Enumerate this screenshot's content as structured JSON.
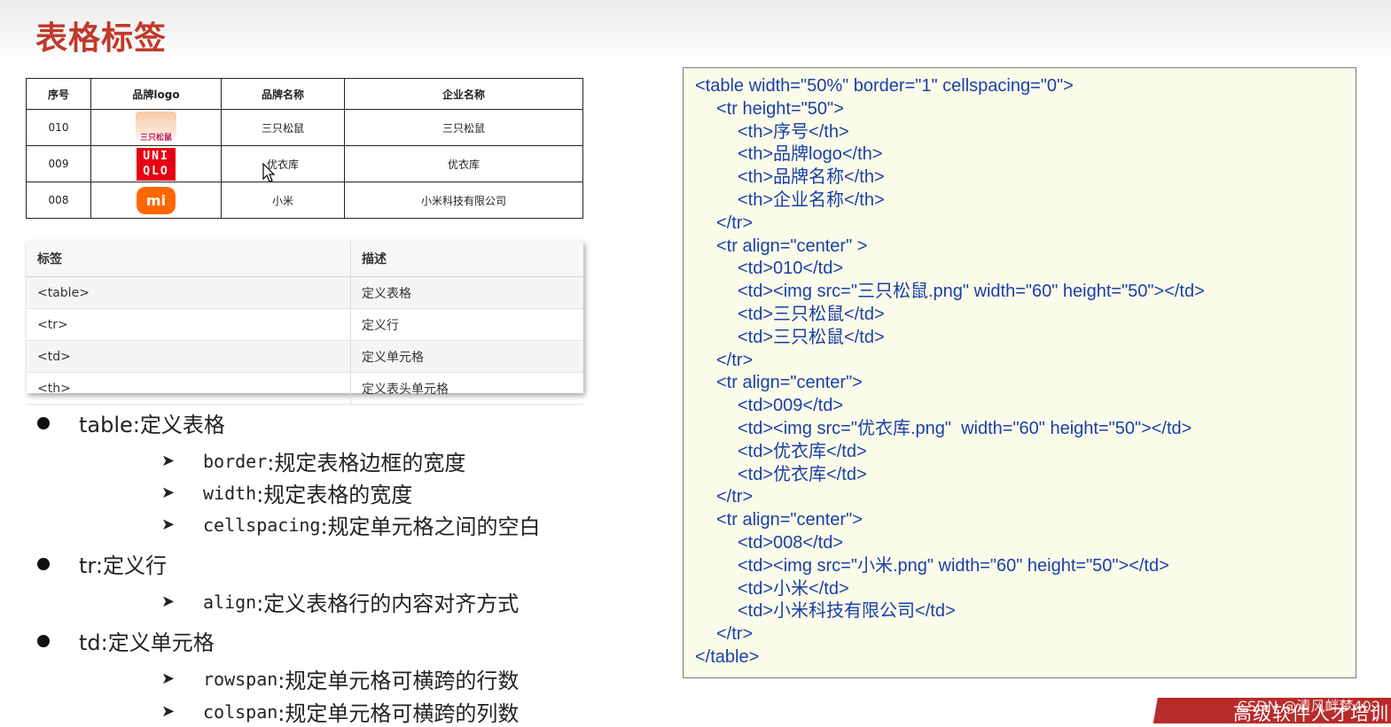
{
  "slide": {
    "title": "表格标签"
  },
  "demo_table": {
    "headers": [
      "序号",
      "品牌logo",
      "品牌名称",
      "企业名称"
    ],
    "rows": [
      {
        "id": "010",
        "logo": "三只松鼠",
        "brand": "三只松鼠",
        "company": "三只松鼠"
      },
      {
        "id": "009",
        "logo": "UNI QLO",
        "logo_line1": "UNI",
        "logo_line2": "QLO",
        "brand": "优衣库",
        "company": "优衣库"
      },
      {
        "id": "008",
        "logo": "mi",
        "brand": "小米",
        "company": "小米科技有限公司"
      }
    ]
  },
  "tag_table": {
    "headers": [
      "标签",
      "描述"
    ],
    "rows": [
      {
        "tag": "<table>",
        "desc": "定义表格"
      },
      {
        "tag": "<tr>",
        "desc": "定义行"
      },
      {
        "tag": "<td>",
        "desc": "定义单元格"
      },
      {
        "tag": "<th>",
        "desc": "定义表头单元格"
      }
    ]
  },
  "notes": {
    "table": {
      "label": "table:定义表格",
      "items": [
        {
          "attr": "border",
          "text": ":规定表格边框的宽度"
        },
        {
          "attr": "width",
          "text": " :规定表格的宽度"
        },
        {
          "attr": "cellspacing",
          "text": ":规定单元格之间的空白"
        }
      ]
    },
    "tr": {
      "label": "tr:定义行",
      "items": [
        {
          "attr": "align",
          "text": ":定义表格行的内容对齐方式"
        }
      ]
    },
    "td": {
      "label": "td:定义单元格",
      "items": [
        {
          "attr": "rowspan",
          "text": ":规定单元格可横跨的行数"
        },
        {
          "attr": "colspan",
          "text": ":规定单元格可横跨的列数"
        }
      ]
    }
  },
  "code": {
    "l01": "<table width=\"50%\" border=\"1\" cellspacing=\"0\">",
    "l02": "<tr height=\"50\">",
    "l03": "<th>序号</th>",
    "l04": "<th>品牌logo</th>",
    "l05": "<th>品牌名称</th>",
    "l06": "<th>企业名称</th>",
    "l07": "</tr>",
    "l08": "<tr align=\"center\" >",
    "l09": "<td>010</td>",
    "l10": "<td><img src=\"三只松鼠.png\" width=\"60\" height=\"50\"></td>",
    "l11": "<td>三只松鼠</td>",
    "l12": "<td>三只松鼠</td>",
    "l13": "</tr>",
    "l14": "<tr align=\"center\">",
    "l15": "<td>009</td>",
    "l16": "<td><img src=\"优衣库.png\"  width=\"60\" height=\"50\"></td>",
    "l17": "<td>优衣库</td>",
    "l18": "<td>优衣库</td>",
    "l19": "</tr>",
    "l20": "<tr align=\"center\">",
    "l21": "<td>008</td>",
    "l22": "<td><img src=\"小米.png\" width=\"60\" height=\"50\"></td>",
    "l23": "<td>小米</td>",
    "l24": "<td>小米科技有限公司</td>",
    "l25": "</tr>",
    "l26": "</table>"
  },
  "banner": {
    "text": "高级软件人才培训",
    "watermark": "CSDN @清风衅梦402"
  },
  "colors": {
    "title": "#c0392b",
    "code_bg": "#fbfbe9",
    "code_tag": "#1a3fa8",
    "banner": "#b82b2b"
  },
  "icons": {
    "bullet": "filled-circle",
    "sub_bullet": "arrowhead",
    "cursor": "mouse-pointer"
  }
}
